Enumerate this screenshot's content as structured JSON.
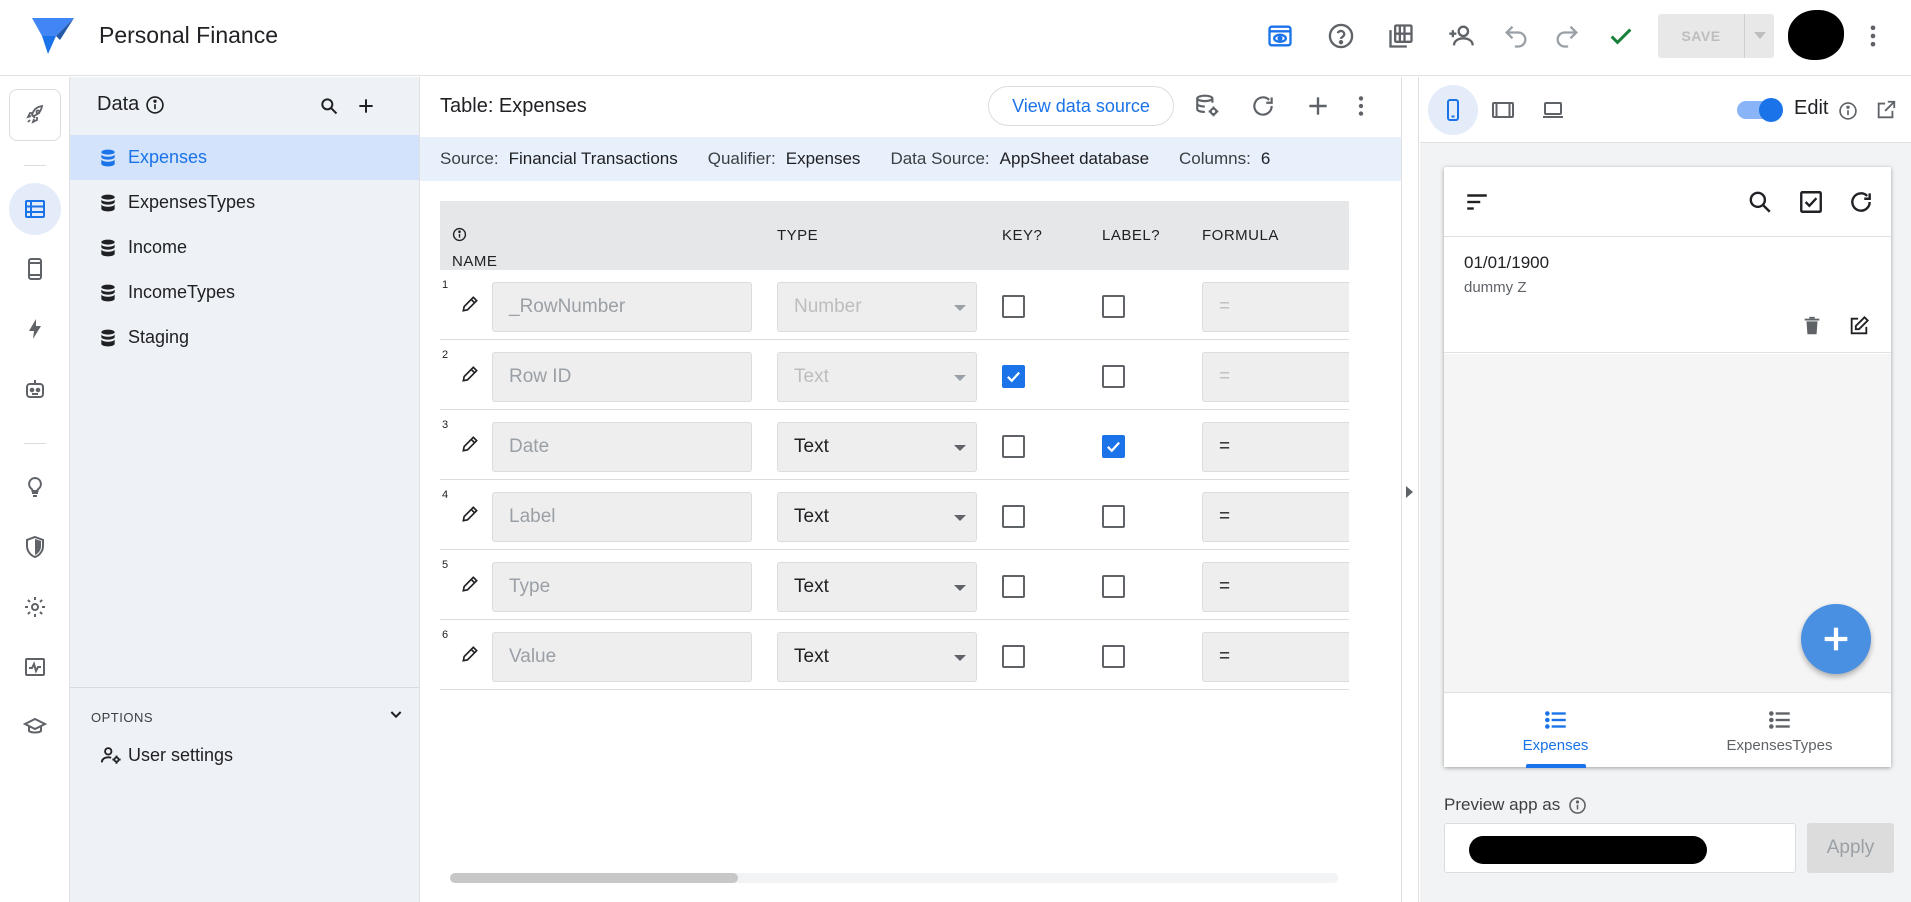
{
  "app": {
    "title": "Personal Finance",
    "save_label": "SAVE"
  },
  "data_panel": {
    "title": "Data",
    "tables": [
      {
        "label": "Expenses",
        "active": true
      },
      {
        "label": "ExpensesTypes",
        "active": false
      },
      {
        "label": "Income",
        "active": false
      },
      {
        "label": "IncomeTypes",
        "active": false
      },
      {
        "label": "Staging",
        "active": false
      }
    ],
    "options_label": "OPTIONS",
    "user_settings_label": "User settings"
  },
  "main": {
    "table_title": "Table: Expenses",
    "view_source_label": "View data source",
    "source_bar": {
      "source_key": "Source:",
      "source_val": "Financial Transactions",
      "qualifier_key": "Qualifier:",
      "qualifier_val": "Expenses",
      "datasource_key": "Data Source:",
      "datasource_val": "AppSheet database",
      "columns_key": "Columns:",
      "columns_val": "6"
    },
    "headers": {
      "name": "NAME",
      "type": "TYPE",
      "key": "KEY?",
      "label": "LABEL?",
      "formula": "FORMULA"
    },
    "rows": [
      {
        "num": "1",
        "name": "_RowNumber",
        "type": "Number",
        "key": false,
        "label": false,
        "formula": "=",
        "dim": true
      },
      {
        "num": "2",
        "name": "Row ID",
        "type": "Text",
        "key": true,
        "label": false,
        "formula": "=",
        "dim": true
      },
      {
        "num": "3",
        "name": "Date",
        "type": "Text",
        "key": false,
        "label": true,
        "formula": "=",
        "dim": false
      },
      {
        "num": "4",
        "name": "Label",
        "type": "Text",
        "key": false,
        "label": false,
        "formula": "=",
        "dim": false
      },
      {
        "num": "5",
        "name": "Type",
        "type": "Text",
        "key": false,
        "label": false,
        "formula": "=",
        "dim": false
      },
      {
        "num": "6",
        "name": "Value",
        "type": "Text",
        "key": false,
        "label": false,
        "formula": "=",
        "dim": false
      }
    ]
  },
  "preview": {
    "edit_label": "Edit",
    "edit_on": true,
    "record": {
      "date": "01/01/1900",
      "sub": "dummy Z"
    },
    "nav_tabs": [
      {
        "label": "Expenses",
        "active": true
      },
      {
        "label": "ExpensesTypes",
        "active": false
      }
    ],
    "preview_as_label": "Preview app as",
    "apply_label": "Apply"
  },
  "colors": {
    "accent": "#1a73e8",
    "success": "#188038"
  }
}
